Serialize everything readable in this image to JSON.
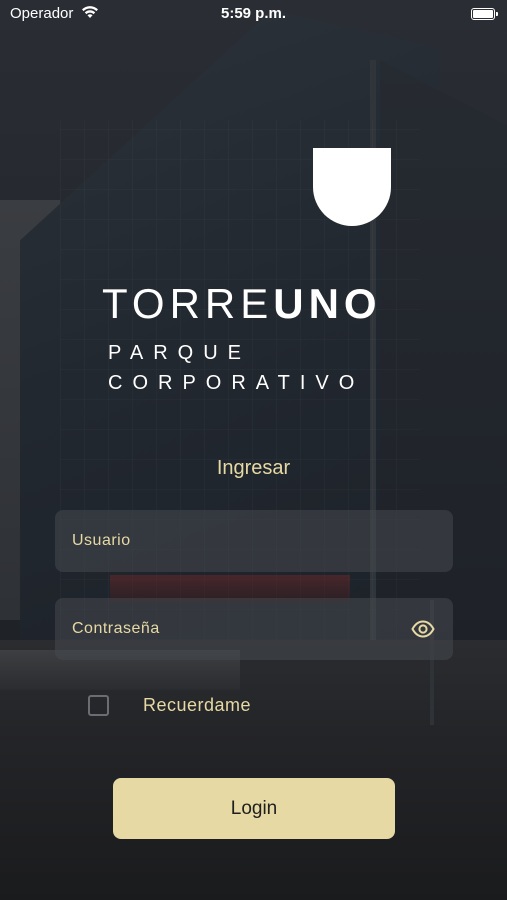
{
  "status_bar": {
    "carrier": "Operador",
    "time": "5:59 p.m.",
    "battery_level": 1.0
  },
  "brand": {
    "name_thin": "TORRE",
    "name_bold": "UNO",
    "subtitle_line1": "PARQUE",
    "subtitle_line2": "CORPORATIVO"
  },
  "form": {
    "heading": "Ingresar",
    "username_placeholder": "Usuario",
    "password_placeholder": "Contraseña",
    "remember_label": "Recuerdame",
    "remember_checked": false,
    "login_label": "Login"
  },
  "colors": {
    "accent": "#e6d9a4",
    "field_bg": "#46484e"
  },
  "icons": {
    "wifi": "wifi-icon",
    "battery": "battery-icon",
    "password_toggle": "eye-icon"
  }
}
